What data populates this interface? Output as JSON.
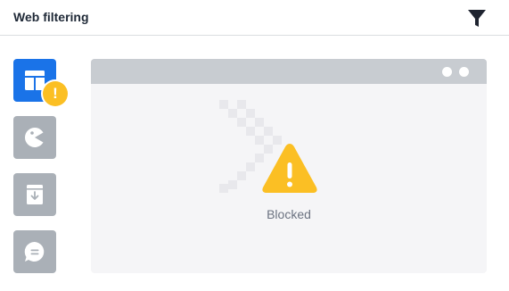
{
  "header": {
    "title": "Web filtering",
    "filter_icon": "filter-icon"
  },
  "sidebar": {
    "items": [
      {
        "name": "layout",
        "icon": "layout-grid-icon",
        "active": true,
        "warning": true
      },
      {
        "name": "games",
        "icon": "pacman-icon",
        "active": false
      },
      {
        "name": "downloads",
        "icon": "archive-download-icon",
        "active": false
      },
      {
        "name": "chat",
        "icon": "chat-bubble-icon",
        "active": false
      }
    ],
    "warning_badge_glyph": "!"
  },
  "browser": {
    "status_text": "Blocked",
    "status_icon": "warning-triangle-icon"
  },
  "colors": {
    "accent": "#1a73e8",
    "warning": "#fbbf24",
    "sidebar_inactive": "#aab0b7",
    "browser_bar": "#c8ccd1",
    "browser_bg": "#f5f5f7"
  }
}
